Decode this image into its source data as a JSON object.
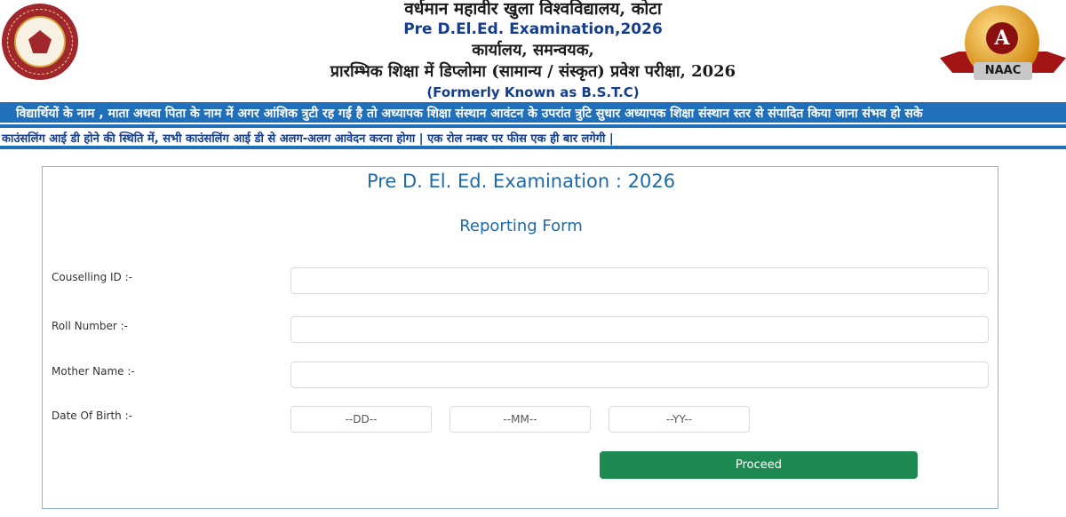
{
  "header": {
    "university_name": "वर्धमान महावीर खुला विश्वविद्यालय, कोटा",
    "exam_title": "Pre D.El.Ed. Examination,2026",
    "office": "कार्यालय, समन्वयक,",
    "diploma_title": "प्रारम्भिक शिक्षा में डिप्लोमा (सामान्य / संस्कृत) प्रवेश परीक्षा, 2026",
    "formerly": "(Formerly Known as B.S.T.C)",
    "naac_grade": "A",
    "naac_label": "NAAC"
  },
  "notices": {
    "line1": "विद्यार्थियों के नाम , माता अथवा पिता के नाम में अगर आंशिक त्रुटी रह गई है तो अध्यापक शिक्षा संस्थान आवंटन के उपरांत त्रुटि सुधार अध्यापक शिक्षा संस्थान स्तर से संपादित किया जाना संभव हो सके",
    "line2": "काउंसलिंग आई डी होने की स्थिति में, सभी काउंसलिंग आई डी से अलग-अलग आवेदन करना होगा | एक रोल नम्बर पर फीस एक ही बार लगेगी |"
  },
  "form": {
    "title": "Pre D. El. Ed. Examination : 2026",
    "subtitle": "Reporting Form",
    "counselling_label": "Couselling ID :-",
    "roll_label": "Roll Number :-",
    "mother_label": "Mother Name :-",
    "dob_label": "Date Of Birth :-",
    "dd_placeholder": "--DD--",
    "mm_placeholder": "--MM--",
    "yy_placeholder": "--YY--",
    "proceed_label": "Proceed"
  },
  "colors": {
    "brand_blue": "#1f6fbb",
    "title_blue": "#1e6aa8",
    "proceed_green": "#1e8a52"
  }
}
